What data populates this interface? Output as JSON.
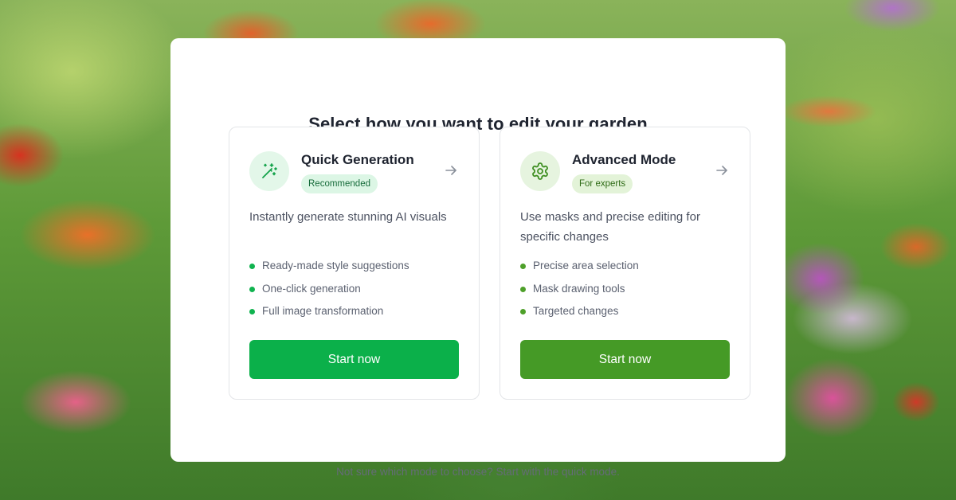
{
  "page": {
    "title": "Select how you want to edit your garden",
    "footer_note": "Not sure which mode to choose? Start with the quick mode."
  },
  "cards": [
    {
      "id": "quick",
      "icon": "magic-wand-icon",
      "title": "Quick Generation",
      "badge": "Recommended",
      "description": "Instantly generate stunning AI visuals",
      "features": [
        "Ready-made style suggestions",
        "One-click generation",
        "Full image transformation"
      ],
      "button_label": "Start now",
      "accent_color": "#0bb04a"
    },
    {
      "id": "advanced",
      "icon": "gear-icon",
      "title": "Advanced Mode",
      "badge": "For experts",
      "description": "Use masks and precise editing for specific changes",
      "features": [
        "Precise area selection",
        "Mask drawing tools",
        "Targeted changes"
      ],
      "button_label": "Start now",
      "accent_color": "#459a26"
    }
  ],
  "colors": {
    "quick_accent": "#0bb04a",
    "advanced_accent": "#459a26",
    "title_text": "#1f2430"
  }
}
